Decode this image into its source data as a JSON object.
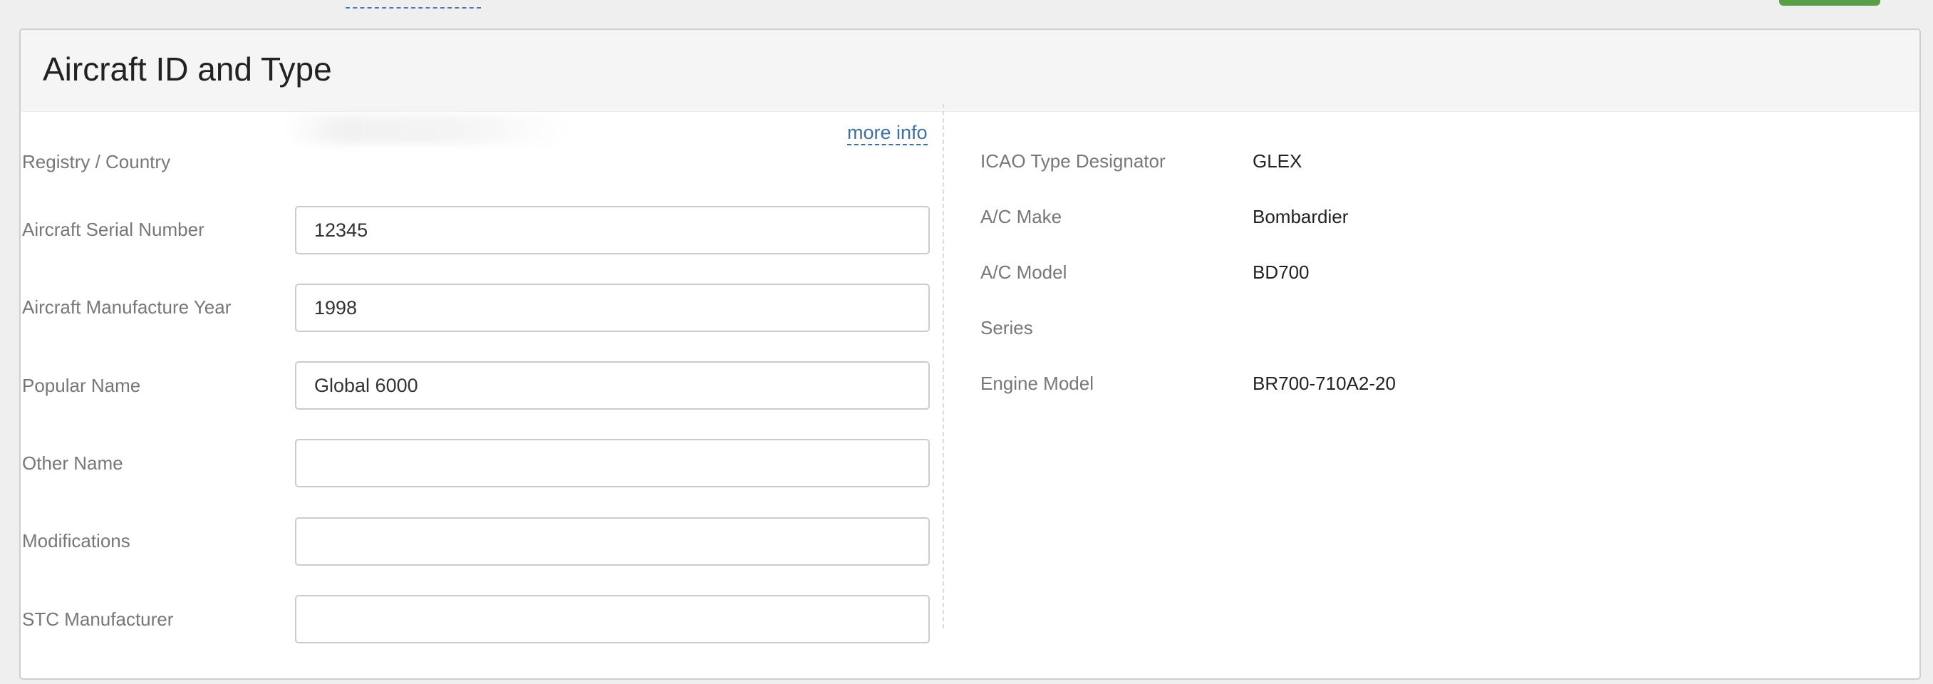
{
  "panel": {
    "title": "Aircraft ID and Type"
  },
  "left_fields": {
    "registry_country": {
      "label": "Registry / Country",
      "link": "more info"
    },
    "serial_number": {
      "label": "Aircraft Serial Number",
      "value": "12345"
    },
    "manufacture_year": {
      "label": "Aircraft Manufacture Year",
      "value": "1998"
    },
    "popular_name": {
      "label": "Popular Name",
      "value": "Global 6000"
    },
    "other_name": {
      "label": "Other Name",
      "value": ""
    },
    "modifications": {
      "label": "Modifications",
      "value": ""
    },
    "stc_manufacturer": {
      "label": "STC Manufacturer",
      "value": ""
    }
  },
  "right_fields": {
    "icao_type": {
      "label": "ICAO Type Designator",
      "value": "GLEX"
    },
    "ac_make": {
      "label": "A/C Make",
      "value": "Bombardier"
    },
    "ac_model": {
      "label": "A/C Model",
      "value": "BD700"
    },
    "series": {
      "label": "Series",
      "value": ""
    },
    "engine_model": {
      "label": "Engine Model",
      "value": "BR700-710A2-20"
    }
  },
  "colors": {
    "link": "#3f6f9e",
    "button_green": "#5a9e4a"
  }
}
